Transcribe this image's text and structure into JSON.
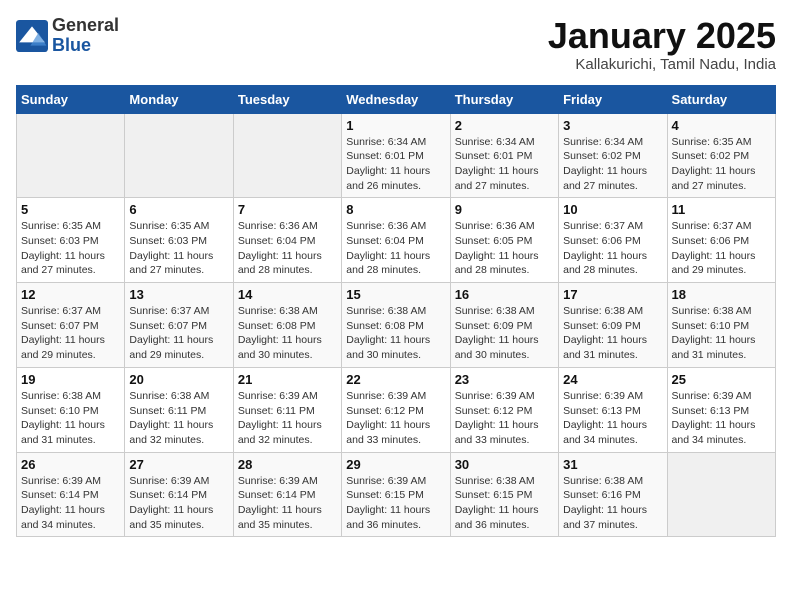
{
  "header": {
    "logo_general": "General",
    "logo_blue": "Blue",
    "title": "January 2025",
    "subtitle": "Kallakurichi, Tamil Nadu, India"
  },
  "days_of_week": [
    "Sunday",
    "Monday",
    "Tuesday",
    "Wednesday",
    "Thursday",
    "Friday",
    "Saturday"
  ],
  "weeks": [
    [
      {
        "day": "",
        "info": ""
      },
      {
        "day": "",
        "info": ""
      },
      {
        "day": "",
        "info": ""
      },
      {
        "day": "1",
        "info": "Sunrise: 6:34 AM\nSunset: 6:01 PM\nDaylight: 11 hours and 26 minutes."
      },
      {
        "day": "2",
        "info": "Sunrise: 6:34 AM\nSunset: 6:01 PM\nDaylight: 11 hours and 27 minutes."
      },
      {
        "day": "3",
        "info": "Sunrise: 6:34 AM\nSunset: 6:02 PM\nDaylight: 11 hours and 27 minutes."
      },
      {
        "day": "4",
        "info": "Sunrise: 6:35 AM\nSunset: 6:02 PM\nDaylight: 11 hours and 27 minutes."
      }
    ],
    [
      {
        "day": "5",
        "info": "Sunrise: 6:35 AM\nSunset: 6:03 PM\nDaylight: 11 hours and 27 minutes."
      },
      {
        "day": "6",
        "info": "Sunrise: 6:35 AM\nSunset: 6:03 PM\nDaylight: 11 hours and 27 minutes."
      },
      {
        "day": "7",
        "info": "Sunrise: 6:36 AM\nSunset: 6:04 PM\nDaylight: 11 hours and 28 minutes."
      },
      {
        "day": "8",
        "info": "Sunrise: 6:36 AM\nSunset: 6:04 PM\nDaylight: 11 hours and 28 minutes."
      },
      {
        "day": "9",
        "info": "Sunrise: 6:36 AM\nSunset: 6:05 PM\nDaylight: 11 hours and 28 minutes."
      },
      {
        "day": "10",
        "info": "Sunrise: 6:37 AM\nSunset: 6:06 PM\nDaylight: 11 hours and 28 minutes."
      },
      {
        "day": "11",
        "info": "Sunrise: 6:37 AM\nSunset: 6:06 PM\nDaylight: 11 hours and 29 minutes."
      }
    ],
    [
      {
        "day": "12",
        "info": "Sunrise: 6:37 AM\nSunset: 6:07 PM\nDaylight: 11 hours and 29 minutes."
      },
      {
        "day": "13",
        "info": "Sunrise: 6:37 AM\nSunset: 6:07 PM\nDaylight: 11 hours and 29 minutes."
      },
      {
        "day": "14",
        "info": "Sunrise: 6:38 AM\nSunset: 6:08 PM\nDaylight: 11 hours and 30 minutes."
      },
      {
        "day": "15",
        "info": "Sunrise: 6:38 AM\nSunset: 6:08 PM\nDaylight: 11 hours and 30 minutes."
      },
      {
        "day": "16",
        "info": "Sunrise: 6:38 AM\nSunset: 6:09 PM\nDaylight: 11 hours and 30 minutes."
      },
      {
        "day": "17",
        "info": "Sunrise: 6:38 AM\nSunset: 6:09 PM\nDaylight: 11 hours and 31 minutes."
      },
      {
        "day": "18",
        "info": "Sunrise: 6:38 AM\nSunset: 6:10 PM\nDaylight: 11 hours and 31 minutes."
      }
    ],
    [
      {
        "day": "19",
        "info": "Sunrise: 6:38 AM\nSunset: 6:10 PM\nDaylight: 11 hours and 31 minutes."
      },
      {
        "day": "20",
        "info": "Sunrise: 6:38 AM\nSunset: 6:11 PM\nDaylight: 11 hours and 32 minutes."
      },
      {
        "day": "21",
        "info": "Sunrise: 6:39 AM\nSunset: 6:11 PM\nDaylight: 11 hours and 32 minutes."
      },
      {
        "day": "22",
        "info": "Sunrise: 6:39 AM\nSunset: 6:12 PM\nDaylight: 11 hours and 33 minutes."
      },
      {
        "day": "23",
        "info": "Sunrise: 6:39 AM\nSunset: 6:12 PM\nDaylight: 11 hours and 33 minutes."
      },
      {
        "day": "24",
        "info": "Sunrise: 6:39 AM\nSunset: 6:13 PM\nDaylight: 11 hours and 34 minutes."
      },
      {
        "day": "25",
        "info": "Sunrise: 6:39 AM\nSunset: 6:13 PM\nDaylight: 11 hours and 34 minutes."
      }
    ],
    [
      {
        "day": "26",
        "info": "Sunrise: 6:39 AM\nSunset: 6:14 PM\nDaylight: 11 hours and 34 minutes."
      },
      {
        "day": "27",
        "info": "Sunrise: 6:39 AM\nSunset: 6:14 PM\nDaylight: 11 hours and 35 minutes."
      },
      {
        "day": "28",
        "info": "Sunrise: 6:39 AM\nSunset: 6:14 PM\nDaylight: 11 hours and 35 minutes."
      },
      {
        "day": "29",
        "info": "Sunrise: 6:39 AM\nSunset: 6:15 PM\nDaylight: 11 hours and 36 minutes."
      },
      {
        "day": "30",
        "info": "Sunrise: 6:38 AM\nSunset: 6:15 PM\nDaylight: 11 hours and 36 minutes."
      },
      {
        "day": "31",
        "info": "Sunrise: 6:38 AM\nSunset: 6:16 PM\nDaylight: 11 hours and 37 minutes."
      },
      {
        "day": "",
        "info": ""
      }
    ]
  ]
}
